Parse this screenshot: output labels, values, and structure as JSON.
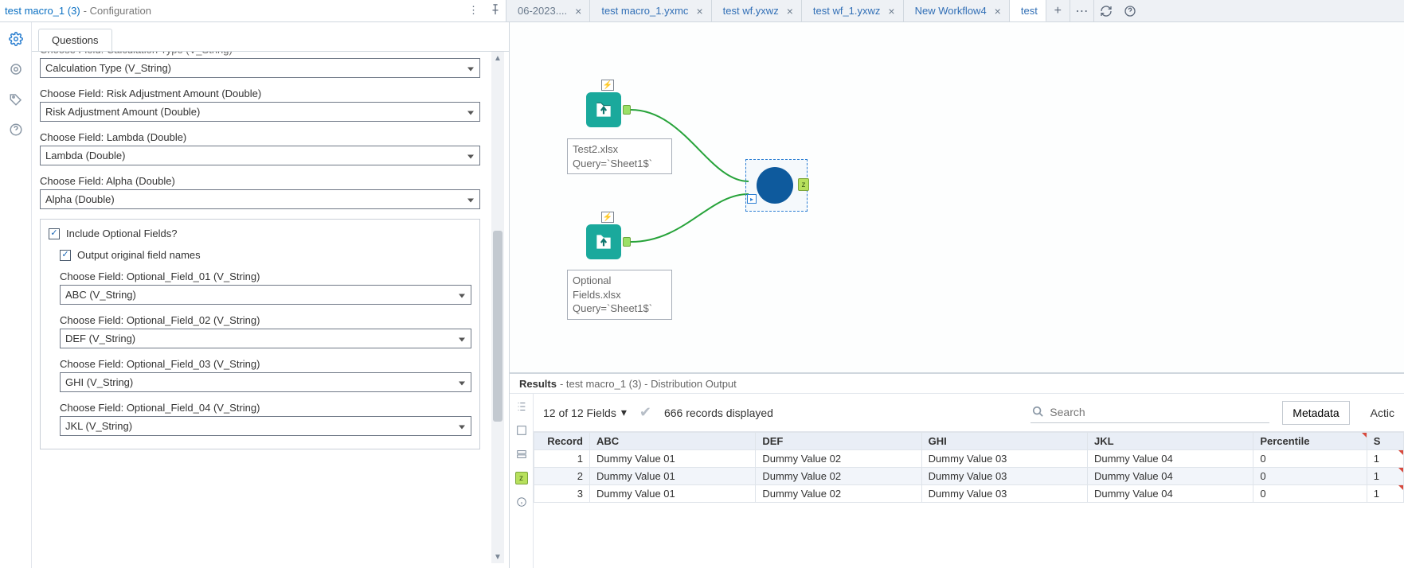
{
  "title": {
    "main": "test macro_1 (3)",
    "sub": "- Configuration"
  },
  "tabs": [
    {
      "label": "06-2023....",
      "closable": true
    },
    {
      "label": "test macro_1.yxmc",
      "closable": true
    },
    {
      "label": "test wf.yxwz",
      "closable": true
    },
    {
      "label": "test wf_1.yxwz",
      "closable": true
    },
    {
      "label": "New Workflow4",
      "closable": true
    },
    {
      "label": "test",
      "closable": false,
      "active": true
    }
  ],
  "config": {
    "tab": "Questions",
    "clipped_label": "Choose Field: Calculation Type (V_String)",
    "fields": {
      "calc_type": {
        "label": "Calculation Type (V_String)",
        "value": "Calculation Type (V_String)"
      },
      "risk_amt": {
        "label": "Choose Field: Risk Adjustment Amount (Double)",
        "value": "Risk Adjustment Amount (Double)"
      },
      "lambda": {
        "label": "Choose Field: Lambda (Double)",
        "value": "Lambda (Double)"
      },
      "alpha": {
        "label": "Choose Field: Alpha (Double)",
        "value": "Alpha (Double)"
      }
    },
    "include_optional": "Include Optional Fields?",
    "output_original": "Output original field names",
    "optional": {
      "f01": {
        "label": "Choose Field: Optional_Field_01 (V_String)",
        "value": "ABC (V_String)"
      },
      "f02": {
        "label": "Choose Field: Optional_Field_02 (V_String)",
        "value": "DEF (V_String)"
      },
      "f03": {
        "label": "Choose Field: Optional_Field_03 (V_String)",
        "value": "GHI (V_String)"
      },
      "f04": {
        "label": "Choose Field: Optional_Field_04 (V_String)",
        "value": "JKL (V_String)"
      }
    }
  },
  "canvas": {
    "tool1": {
      "line1": "Test2.xlsx",
      "line2": "Query=`Sheet1$`"
    },
    "tool2": {
      "line1": "Optional",
      "line2": "Fields.xlsx",
      "line3": "Query=`Sheet1$`"
    }
  },
  "results": {
    "header_bold": "Results",
    "header_rest": " - test macro_1 (3) - Distribution Output",
    "fields_label": "12 of 12 Fields",
    "records_label": "666 records displayed",
    "search_placeholder": "Search",
    "metadata_label": "Metadata",
    "actions_label": "Actic",
    "columns": [
      "Record",
      "ABC",
      "DEF",
      "GHI",
      "JKL",
      "Percentile",
      "S"
    ],
    "rows": [
      {
        "record": "1",
        "c": [
          "Dummy Value 01",
          "Dummy Value 02",
          "Dummy Value 03",
          "Dummy Value 04",
          "0",
          "1"
        ]
      },
      {
        "record": "2",
        "c": [
          "Dummy Value 01",
          "Dummy Value 02",
          "Dummy Value 03",
          "Dummy Value 04",
          "0",
          "1"
        ]
      },
      {
        "record": "3",
        "c": [
          "Dummy Value 01",
          "Dummy Value 02",
          "Dummy Value 03",
          "Dummy Value 04",
          "0",
          "1"
        ]
      }
    ]
  }
}
